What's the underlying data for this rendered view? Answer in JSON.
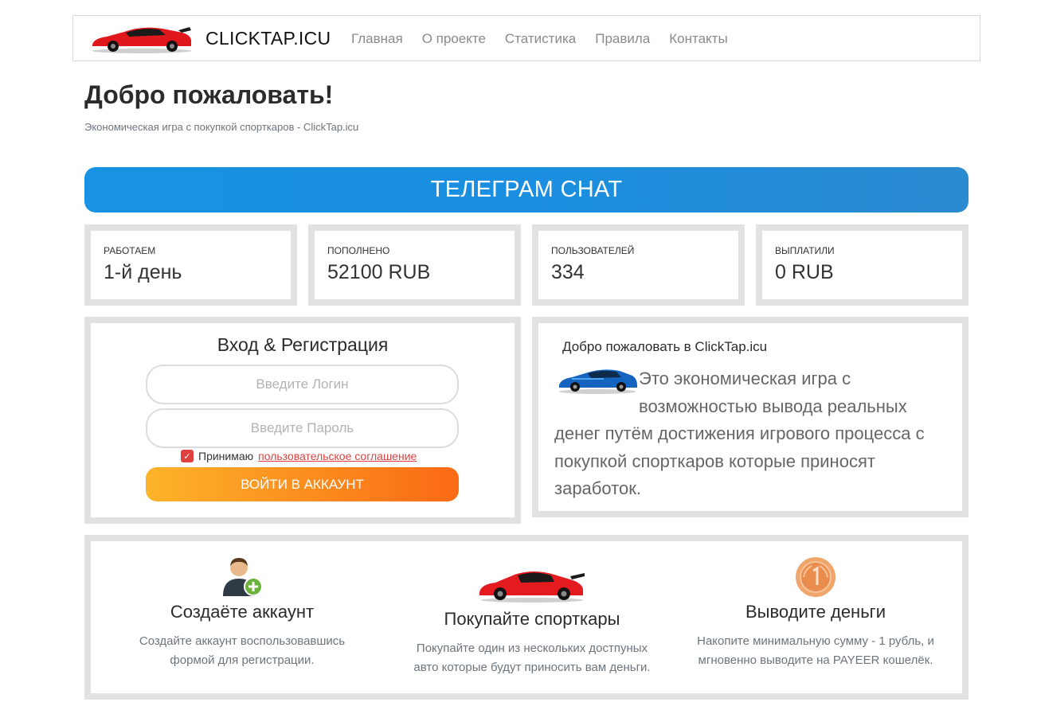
{
  "nav": {
    "brand": "CLICKTAP.ICU",
    "links": [
      "Главная",
      "О проекте",
      "Статистика",
      "Правила",
      "Контакты"
    ]
  },
  "hero": {
    "title": "Добро пожаловать!",
    "subtitle": "Экономическая игра с покупкой спорткаров - ClickTap.icu",
    "telegram_label": "ТЕЛЕГРАМ СНАТ"
  },
  "stats": [
    {
      "label": "РАБОТАЕМ",
      "value": "1-й день"
    },
    {
      "label": "ПОПОЛНЕНО",
      "value": "52100 RUB"
    },
    {
      "label": "ПОЛЬЗОВАТЕЛЕЙ",
      "value": "334"
    },
    {
      "label": "ВЫПЛАТИЛИ",
      "value": "0 RUB"
    }
  ],
  "login": {
    "title": "Вход & Регистрация",
    "login_placeholder": "Введите Логин",
    "password_placeholder": "Введите Пароль",
    "agree_text": "Принимаю",
    "agree_link": "пользовательское соглашение",
    "submit_label": "ВОЙТИ В АККАУНТ",
    "agree_checked": true
  },
  "info": {
    "title": "Добро пожаловать в ClickTap.icu",
    "text": "Это экономическая игра с возможностью вывода реальных денег путём достижения игрового процесса с покупкой спорткаров которые приносят заработок."
  },
  "features": [
    {
      "icon": "add-user-icon",
      "title": "Создаёте аккаунт",
      "desc_line1": "Создайте аккаунт воспользовавшись",
      "desc_line2": "формой для регистрации."
    },
    {
      "icon": "sports-car-icon",
      "title": "Покупайте спорткары",
      "desc_line1": "Покупайте один из нескольких достпуных",
      "desc_line2": "авто которые будут приносить вам деньги."
    },
    {
      "icon": "coin-icon",
      "title": "Выводите деньги",
      "desc_line1": "Накопите минимальную сумму - 1 рубль, и",
      "desc_line2": "мгновенно выводите на PAYEER кошелёк."
    }
  ],
  "colors": {
    "telegram_blue": "#1a8ee0",
    "login_orange": "#fb8f1f",
    "agree_red": "#e0413e",
    "panel_border": "#e2e2e2"
  }
}
